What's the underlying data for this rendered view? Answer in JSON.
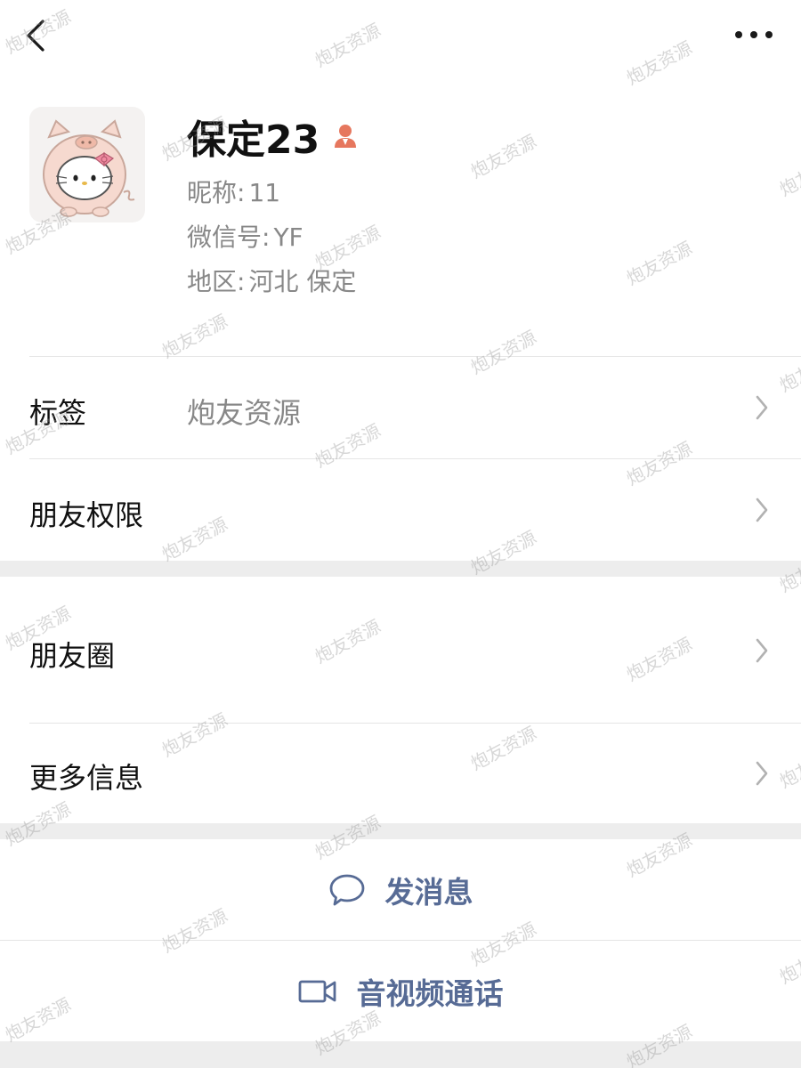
{
  "profile": {
    "display_name": "保定23",
    "nickname_label": "昵称:",
    "nickname_value": "11",
    "wechat_id_label": "微信号:",
    "wechat_id_value": "YF",
    "region_label": "地区:",
    "region_value": "河北  保定",
    "gender": "female",
    "gender_icon": "person-female-icon"
  },
  "rows": {
    "tags_label": "标签",
    "tags_value": "炮友资源",
    "permissions_label": "朋友权限",
    "moments_label": "朋友圈",
    "more_info_label": "更多信息"
  },
  "actions": {
    "message_label": "发消息",
    "call_label": "音视频通话"
  },
  "watermark_text": "炮友资源",
  "colors": {
    "link": "#576b95",
    "gender_female": "#e6775e",
    "separator_band": "#ededed"
  }
}
